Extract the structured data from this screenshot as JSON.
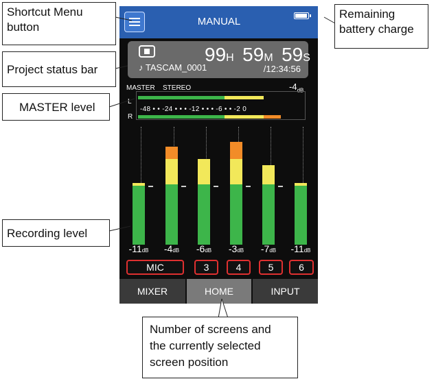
{
  "header": {
    "title": "MANUAL",
    "battery_level_percent": 90
  },
  "status_bar": {
    "hours": "99",
    "hours_unit": "H",
    "minutes": "59",
    "minutes_unit": "M",
    "seconds": "59",
    "seconds_unit": "S",
    "project_name": "♪ TASCAM_0001",
    "remaining_time": "/12:34:56"
  },
  "master": {
    "label": "MASTER",
    "mode": "STEREO",
    "level": "-4",
    "unit": "dB",
    "channel_left": "L",
    "channel_right": "R",
    "scale": "-48  •  •  -24  •  •  •  -12  •  •  •  -6  •  •  -2 0"
  },
  "channels": [
    {
      "name": "MIC",
      "level": "-11",
      "unit": "dB"
    },
    {
      "name": "3",
      "level": "-4",
      "unit": "dB"
    },
    {
      "name": "4",
      "level": "-6",
      "unit": "dB"
    },
    {
      "name": "5",
      "level": "-3",
      "unit": "dB"
    },
    {
      "name": "6",
      "level": "-7",
      "unit": "dB"
    },
    {
      "name": "",
      "level": "-11",
      "unit": "dB"
    }
  ],
  "tabs": [
    {
      "label": "MIXER"
    },
    {
      "label": "HOME"
    },
    {
      "label": "INPUT"
    }
  ],
  "callouts": {
    "shortcut_menu": "Shortcut Menu button",
    "battery": "Remaining battery charge",
    "project_status": "Project status bar",
    "master_level": "MASTER level",
    "recording_level": "Recording level",
    "screens": "Number of screens and the currently selected screen position"
  },
  "colors": {
    "header": "#2a5fb0",
    "meter_green": "#3db54a",
    "meter_yellow": "#f2e85a",
    "meter_orange": "#f28c28",
    "channel_border": "#e03030"
  }
}
